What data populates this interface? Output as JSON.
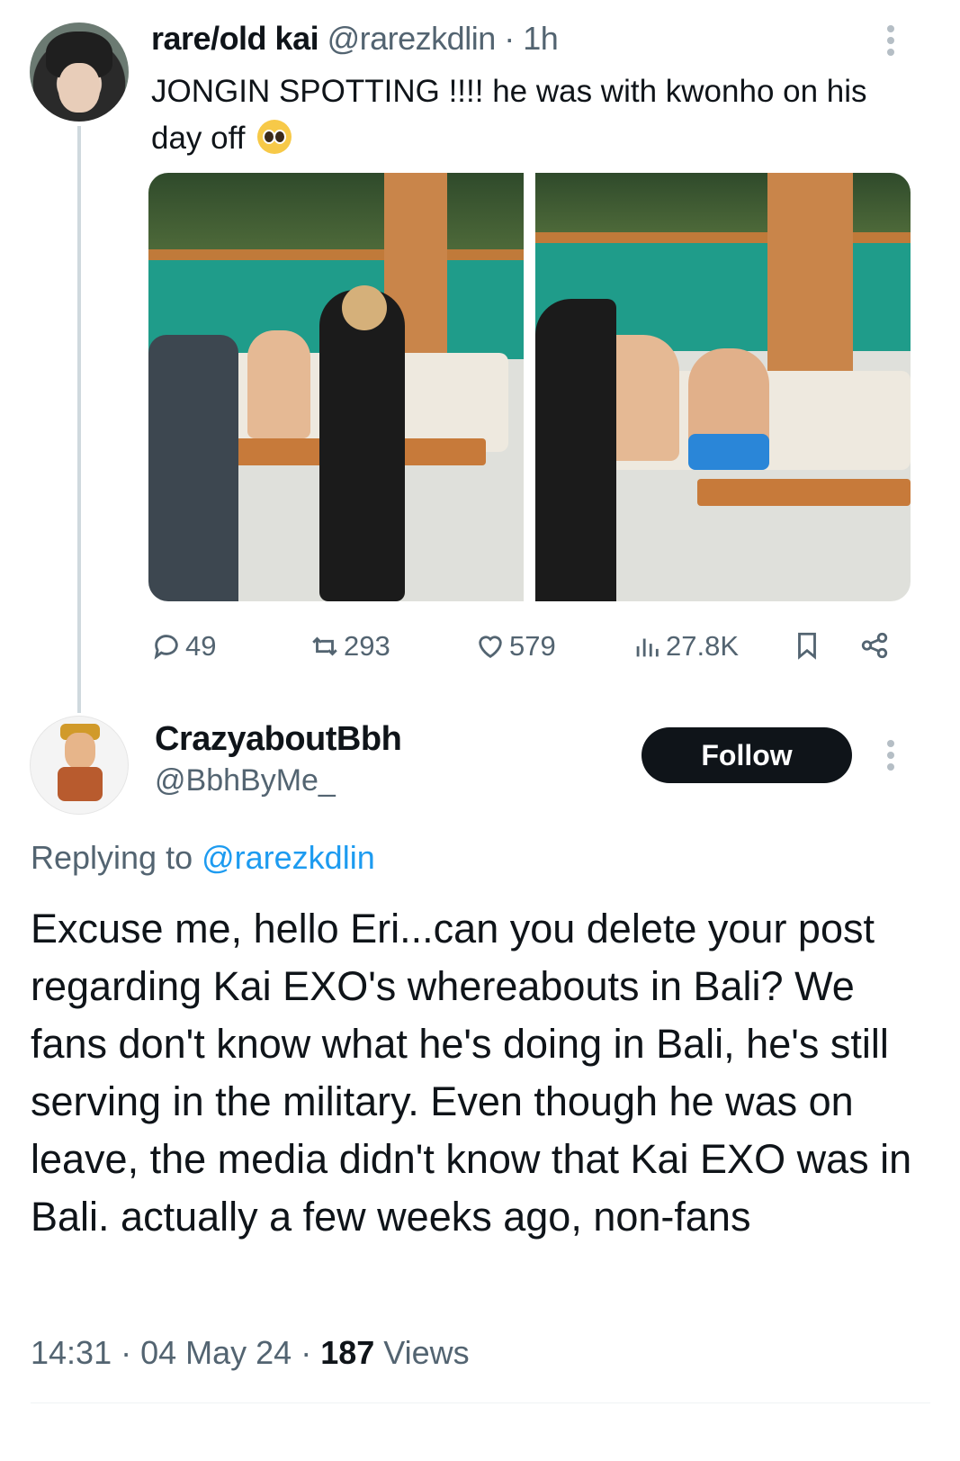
{
  "tweet1": {
    "display_name": "rare/old kai",
    "handle": "@rarezkdlin",
    "time": " · 1h",
    "text": "JONGIN SPOTTING !!!! he was with kwonho on his day off",
    "emoji": "pleading-face-emoji",
    "images": [
      "photo-left",
      "photo-right"
    ],
    "stats": {
      "replies": "49",
      "retweets": "293",
      "likes": "579",
      "views": "27.8K"
    }
  },
  "tweet2": {
    "display_name": "CrazyaboutBbh",
    "handle": "@BbhByMe_",
    "follow_label": "Follow",
    "replying_prefix": "Replying to ",
    "replying_to": "@rarezkdlin",
    "text": "Excuse me, hello Eri...can you delete your post regarding Kai EXO's whereabouts in Bali? We fans don't know what he's doing in Bali, he's still serving in the military. Even though he was on leave, the media didn't know that Kai EXO was in Bali. actually a few weeks ago, non-fans",
    "time": "14:31",
    "sep1": " · ",
    "date": "04 May 24",
    "sep2": " · ",
    "views_count": "187",
    "views_label": " Views"
  },
  "colors": {
    "text_primary": "#0f1419",
    "text_secondary": "#536471",
    "link": "#1d9bf0",
    "follow_bg": "#0f1419"
  }
}
